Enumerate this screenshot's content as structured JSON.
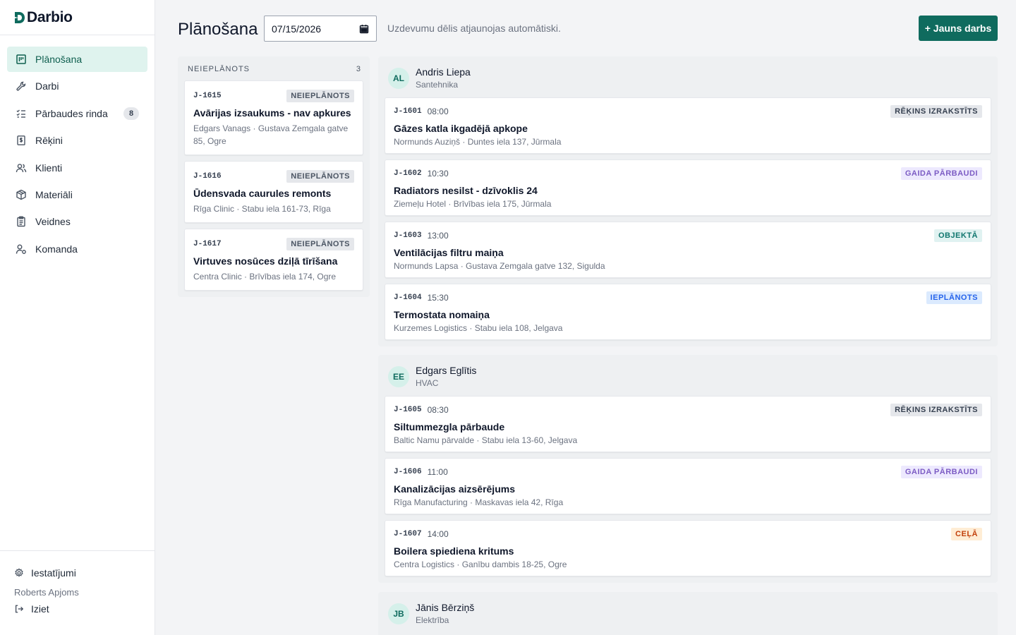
{
  "app": {
    "brand": "Darbio",
    "color_accent": "#0f6b5e"
  },
  "sidebar": {
    "items": [
      {
        "label": "Plānošana",
        "icon": "board-icon",
        "active": true
      },
      {
        "label": "Darbi",
        "icon": "wrench-icon"
      },
      {
        "label": "Pārbaudes rinda",
        "icon": "checklist-icon",
        "badge": "8"
      },
      {
        "label": "Rēķini",
        "icon": "invoice-icon"
      },
      {
        "label": "Klienti",
        "icon": "users-icon"
      },
      {
        "label": "Materiāli",
        "icon": "box-icon"
      },
      {
        "label": "Veidnes",
        "icon": "clipboard-icon"
      },
      {
        "label": "Komanda",
        "icon": "team-icon"
      }
    ],
    "settings_label": "Iestatījumi",
    "user_name": "Roberts Apjoms",
    "logout_label": "Iziet"
  },
  "header": {
    "title": "Plānošana",
    "date_value": "07/15/2026",
    "hint": "Uzdevumu dēlis atjaunojas automātiski.",
    "new_job_label": "+ Jauns darbs"
  },
  "unscheduled": {
    "title": "NEIEPLĀNOTS",
    "count": "3",
    "cards": [
      {
        "id": "J-1615",
        "badge": "NEIEPLĀNOTS",
        "title": "Avārijas izsaukums - nav apkures",
        "meta": "Edgars Vanags · Gustava Zemgala gatve 85, Ogre"
      },
      {
        "id": "J-1616",
        "badge": "NEIEPLĀNOTS",
        "title": "Ūdensvada caurules remonts",
        "meta": "Rīga Clinic · Stabu iela 161-73, Rīga"
      },
      {
        "id": "J-1617",
        "badge": "NEIEPLĀNOTS",
        "title": "Virtuves nosūces dziļā tīrīšana",
        "meta": "Centra Clinic · Brīvības iela 174, Ogre"
      }
    ]
  },
  "technicians": [
    {
      "initials": "AL",
      "name": "Andris Liepa",
      "skill": "Santehnika",
      "jobs": [
        {
          "id": "J-1601",
          "time": "08:00",
          "badge": "RĒĶINS IZRAKSTĪTS",
          "status": "invoiced",
          "title": "Gāzes katla ikgadējā apkope",
          "meta": "Normunds Auziņš · Duntes iela 137, Jūrmala"
        },
        {
          "id": "J-1602",
          "time": "10:30",
          "badge": "GAIDA PĀRBAUDI",
          "status": "await",
          "title": "Radiators nesilst - dzīvoklis 24",
          "meta": "Ziemeļu Hotel · Brīvības iela 175, Jūrmala"
        },
        {
          "id": "J-1603",
          "time": "13:00",
          "badge": "OBJEKTĀ",
          "status": "onsite",
          "title": "Ventilācijas filtru maiņa",
          "meta": "Normunds Lapsa · Gustava Zemgala gatve 132, Sigulda"
        },
        {
          "id": "J-1604",
          "time": "15:30",
          "badge": "IEPLĀNOTS",
          "status": "sched",
          "title": "Termostata nomaiņa",
          "meta": "Kurzemes Logistics · Stabu iela 108, Jelgava"
        }
      ]
    },
    {
      "initials": "EE",
      "name": "Edgars Eglītis",
      "skill": "HVAC",
      "jobs": [
        {
          "id": "J-1605",
          "time": "08:30",
          "badge": "RĒĶINS IZRAKSTĪTS",
          "status": "invoiced",
          "title": "Siltummezgla pārbaude",
          "meta": "Baltic Namu pārvalde · Stabu iela 13-60, Jelgava"
        },
        {
          "id": "J-1606",
          "time": "11:00",
          "badge": "GAIDA PĀRBAUDI",
          "status": "await",
          "title": "Kanalizācijas aizsērējums",
          "meta": "Rīga Manufacturing · Maskavas iela 42, Rīga"
        },
        {
          "id": "J-1607",
          "time": "14:00",
          "badge": "CEĻĀ",
          "status": "enroute",
          "title": "Boilera spiediena kritums",
          "meta": "Centra Logistics · Ganību dambis 18-25, Ogre"
        }
      ]
    },
    {
      "initials": "JB",
      "name": "Jānis Bērziņš",
      "skill": "Elektrība",
      "jobs": []
    }
  ]
}
